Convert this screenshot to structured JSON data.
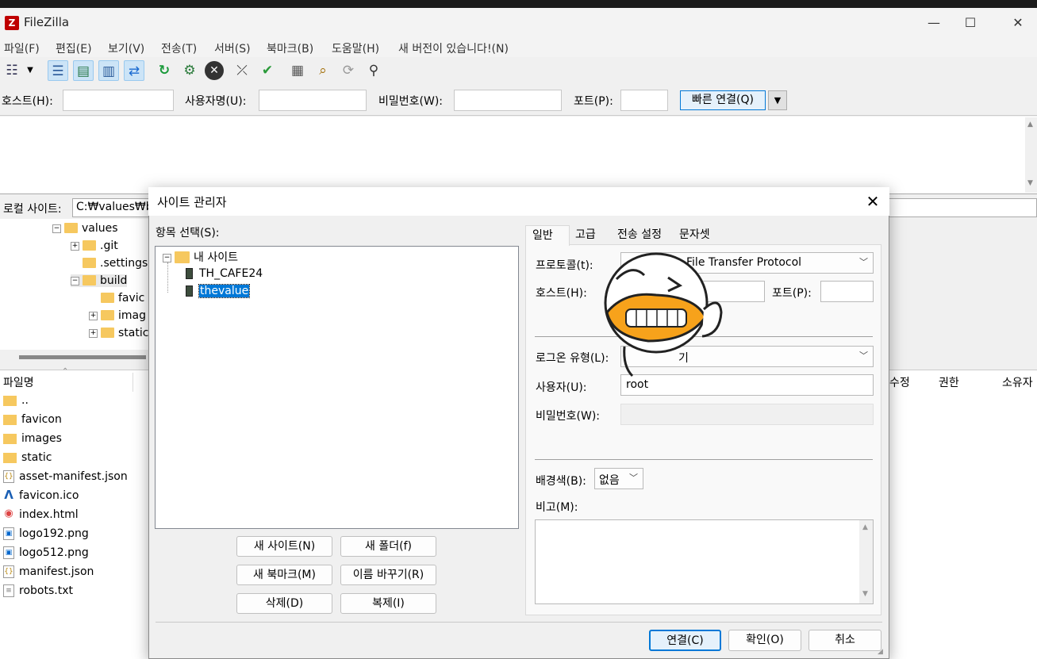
{
  "app": {
    "title": "FileZilla",
    "icon_letter": "Z"
  },
  "window_buttons": {
    "minimize": "—",
    "maximize": "☐",
    "close": "✕"
  },
  "menu": [
    "파일(F)",
    "편집(E)",
    "보기(V)",
    "전송(T)",
    "서버(S)",
    "북마크(B)",
    "도움말(H)",
    "새 버전이 있습니다!(N)"
  ],
  "toolbar_icons": [
    "site-manager-icon",
    "message-log-icon",
    "local-tree-icon",
    "remote-tree-icon",
    "transfer-queue-icon",
    "refresh-icon",
    "process-queue-icon",
    "cancel-icon",
    "disconnect-icon",
    "reconnect-icon",
    "directory-listing-filters-icon",
    "search-icon",
    "compare-icon",
    "find-files-icon"
  ],
  "quickconnect": {
    "host_label": "호스트(H):",
    "user_label": "사용자명(U):",
    "pass_label": "비밀번호(W):",
    "port_label": "포트(P):",
    "button_label": "빠른 연결(Q)",
    "host_value": "",
    "user_value": "",
    "pass_value": "",
    "port_value": ""
  },
  "local": {
    "label": "로컬 사이트:",
    "path": "C:₩values₩bu",
    "tree": [
      {
        "name": "values",
        "expanded": true
      },
      {
        "name": ".git"
      },
      {
        "name": ".settings"
      },
      {
        "name": "build",
        "expanded": true
      },
      {
        "name": "favic"
      },
      {
        "name": "imag"
      },
      {
        "name": "static"
      }
    ],
    "file_header": "파일명",
    "files": [
      {
        "name": "..",
        "type": "folder"
      },
      {
        "name": "favicon",
        "type": "folder"
      },
      {
        "name": "images",
        "type": "folder"
      },
      {
        "name": "static",
        "type": "folder"
      },
      {
        "name": "asset-manifest.json",
        "type": "json"
      },
      {
        "name": "favicon.ico",
        "type": "ico"
      },
      {
        "name": "index.html",
        "type": "html"
      },
      {
        "name": "logo192.png",
        "type": "png"
      },
      {
        "name": "logo512.png",
        "type": "png"
      },
      {
        "name": "manifest.json",
        "type": "json"
      },
      {
        "name": "robots.txt",
        "type": "txt"
      }
    ]
  },
  "remote_headers": {
    "modified": "수정",
    "permissions": "권한",
    "owner": "소유자"
  },
  "dialog": {
    "title": "사이트 관리자",
    "close": "✕",
    "select_label": "항목 선택(S):",
    "root_folder": "내 사이트",
    "sites": [
      "TH_CAFE24",
      "thevalue"
    ],
    "selected_site": "thevalue",
    "buttons": {
      "new_site": "새 사이트(N)",
      "new_folder": "새 폴더(f)",
      "new_bookmark": "새 북마크(M)",
      "rename": "이름 바꾸기(R)",
      "delete": "삭제(D)",
      "duplicate": "복제(I)",
      "connect": "연결(C)",
      "ok": "확인(O)",
      "cancel": "취소"
    },
    "tabs": [
      "일반",
      "고급",
      "전송 설정",
      "문자셋"
    ],
    "active_tab": "일반",
    "general": {
      "protocol_label": "프로토콜(t):",
      "protocol_value": "File Transfer Protocol",
      "host_label": "호스트(H):",
      "host_value": "",
      "port_label": "포트(P):",
      "port_value": "",
      "logon_label": "로그온 유형(L):",
      "logon_value": "기",
      "user_label": "사용자(U):",
      "user_value": "root",
      "password_label": "비밀번호(W):",
      "bg_label": "배경색(B):",
      "bg_value": "없음",
      "comment_label": "비고(M):"
    }
  },
  "colors": {
    "selection": "#0078d7",
    "folder": "#f6c85f",
    "accent_border": "#0078d7"
  }
}
